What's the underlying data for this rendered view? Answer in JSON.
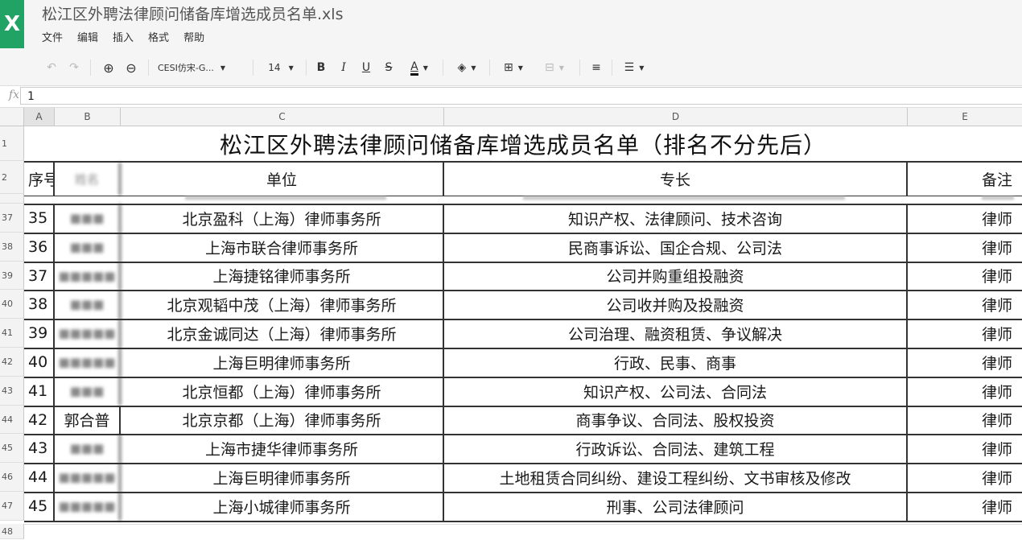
{
  "app": {
    "icon_letter": "X",
    "doc_title": "松江区外聘法律顾问储备库增选成员名单.xls"
  },
  "menu": [
    "文件",
    "编辑",
    "插入",
    "格式",
    "帮助"
  ],
  "toolbar": {
    "font_name": "CESI仿宋-G...",
    "font_size": "14",
    "bold": "B",
    "italic": "I",
    "underline": "U",
    "strike": "S",
    "font_color": "A",
    "undo_icon": "undo-icon",
    "redo_icon": "redo-icon"
  },
  "formula": {
    "fx": "fx",
    "value": "1"
  },
  "columns": [
    "A",
    "B",
    "C",
    "D",
    "E"
  ],
  "sheet": {
    "title": "松江区外聘法律顾问储备库增选成员名单（排名不分先后）",
    "header": {
      "seq": "序号",
      "name": "姓名",
      "org": "单位",
      "specialty": "专长",
      "note": "备注"
    },
    "header_row_num": "2",
    "title_row_num": "1",
    "rows": [
      {
        "row": "37",
        "seq": "35",
        "name": "■■■",
        "org": "北京盈科（上海）律师事务所",
        "specialty": "知识产权、法律顾问、技术咨询",
        "note": "律师"
      },
      {
        "row": "38",
        "seq": "36",
        "name": "■■■",
        "org": "上海市联合律师事务所",
        "specialty": "民商事诉讼、国企合规、公司法",
        "note": "律师"
      },
      {
        "row": "39",
        "seq": "37",
        "name": "■■■■■",
        "org": "上海捷铭律师事务所",
        "specialty": "公司并购重组投融资",
        "note": "律师"
      },
      {
        "row": "40",
        "seq": "38",
        "name": "■■■",
        "org": "北京观韬中茂（上海）律师事务所",
        "specialty": "公司收并购及投融资",
        "note": "律师"
      },
      {
        "row": "41",
        "seq": "39",
        "name": "■■■■■",
        "org": "北京金诚同达（上海）律师事务所",
        "specialty": "公司治理、融资租赁、争议解决",
        "note": "律师"
      },
      {
        "row": "42",
        "seq": "40",
        "name": "■■■■■",
        "org": "上海巨明律师事务所",
        "specialty": "行政、民事、商事",
        "note": "律师"
      },
      {
        "row": "43",
        "seq": "41",
        "name": "■■■",
        "org": "北京恒都（上海）律师事务所",
        "specialty": "知识产权、公司法、合同法",
        "note": "律师"
      },
      {
        "row": "44",
        "seq": "42",
        "name": "郭合普",
        "org": "北京京都（上海）律师事务所",
        "specialty": "商事争议、合同法、股权投资",
        "note": "律师"
      },
      {
        "row": "45",
        "seq": "43",
        "name": "■■■",
        "org": "上海市捷华律师事务所",
        "specialty": "行政诉讼、合同法、建筑工程",
        "note": "律师"
      },
      {
        "row": "46",
        "seq": "44",
        "name": "■■■■■",
        "org": "上海巨明律师事务所",
        "specialty": "土地租赁合同纠纷、建设工程纠纷、文书审核及修改",
        "note": "律师"
      },
      {
        "row": "47",
        "seq": "45",
        "name": "■■■■■",
        "org": "上海小城律师事务所",
        "specialty": "刑事、公司法律顾问",
        "note": "律师"
      }
    ],
    "bottom_row_num": "48"
  },
  "colors": {
    "app_green": "#21a366",
    "grid_border": "#333333",
    "header_bg": "#f3f3f3"
  }
}
